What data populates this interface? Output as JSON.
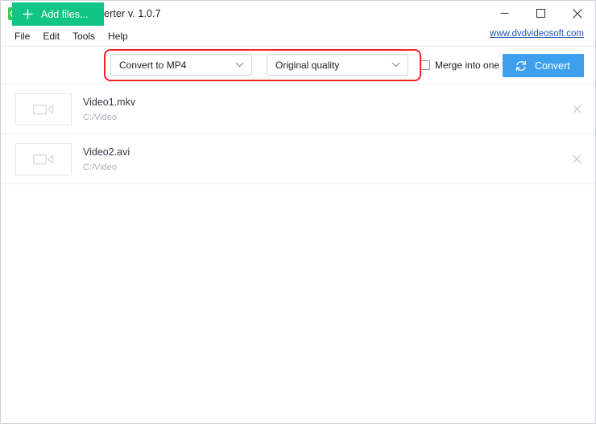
{
  "window": {
    "title": "Free Video Converter v. 1.0.7",
    "app_icon": "video-play-icon",
    "controls": {
      "minimize": "minimize-icon",
      "maximize": "maximize-icon",
      "close": "close-icon"
    }
  },
  "menu": {
    "items": [
      {
        "label": "File"
      },
      {
        "label": "Edit"
      },
      {
        "label": "Tools"
      },
      {
        "label": "Help"
      }
    ],
    "site_link": "www.dvdvideosoft.com"
  },
  "toolbar": {
    "add_files_label": "Add files...",
    "add_files_icon": "plus-icon",
    "format_select": {
      "value": "Convert to MP4",
      "chevron": "chevron-down-icon"
    },
    "quality_select": {
      "value": "Original quality",
      "chevron": "chevron-down-icon"
    },
    "merge_checkbox": {
      "label": "Merge into one file",
      "checked": false
    },
    "convert_label": "Convert",
    "convert_icon": "refresh-icon",
    "highlight": {
      "color": "#f3232b",
      "note": "red-highlight-rectangle"
    }
  },
  "colors": {
    "add_files_green": "#10c585",
    "convert_blue": "#3da0ef",
    "highlight_red": "#f3232b",
    "link_blue": "#2255aa",
    "app_icon_green": "#3fca52"
  },
  "file_list": {
    "remove_icon": "close-icon",
    "thumb_icon": "video-camera-icon",
    "items": [
      {
        "name": "Video1.mkv",
        "path": "C:/Video"
      },
      {
        "name": "Video2.avi",
        "path": "C:/Video"
      }
    ]
  }
}
